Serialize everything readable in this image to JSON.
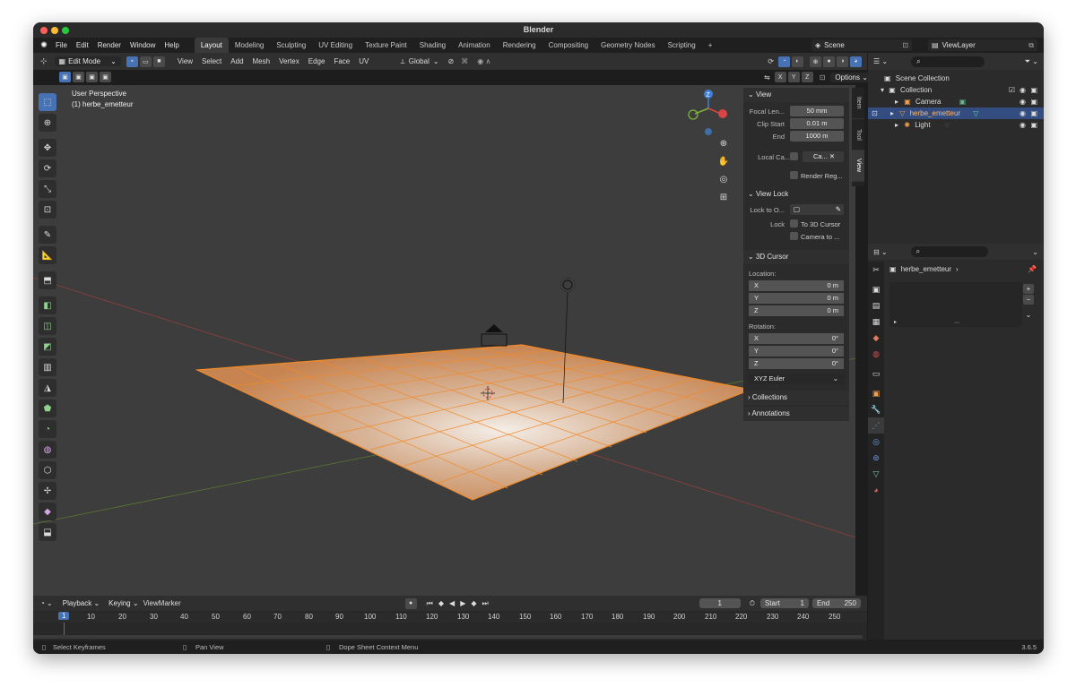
{
  "window": {
    "title": "Blender"
  },
  "menu": [
    "File",
    "Edit",
    "Render",
    "Window",
    "Help"
  ],
  "workspaces": [
    "Layout",
    "Modeling",
    "Sculpting",
    "UV Editing",
    "Texture Paint",
    "Shading",
    "Animation",
    "Rendering",
    "Compositing",
    "Geometry Nodes",
    "Scripting"
  ],
  "workspace_add": "+",
  "scene": {
    "name": "Scene",
    "view_layer": "ViewLayer"
  },
  "viewport_header": {
    "mode": "Edit Mode",
    "menus": [
      "View",
      "Select",
      "Add",
      "Mesh",
      "Vertex",
      "Edge",
      "Face",
      "UV"
    ],
    "orientation": "Global",
    "axis": [
      "X",
      "Y",
      "Z"
    ],
    "options": "Options"
  },
  "viewport": {
    "perspective": "User Perspective",
    "object_label": "(1) herbe_emetteur"
  },
  "side_tabs": [
    "Item",
    "Tool",
    "View"
  ],
  "npanel": {
    "view_title": "View",
    "focal_length": {
      "label": "Focal Len...",
      "value": "50 mm"
    },
    "clip_start": {
      "label": "Clip Start",
      "value": "0.01 m"
    },
    "end": {
      "label": "End",
      "value": "1000 m"
    },
    "local_camera": {
      "label": "Local Ca...",
      "value": "Ca..."
    },
    "render_region": "Render Reg...",
    "view_lock_title": "View Lock",
    "lock_to_object": "Lock to O...",
    "lock": "Lock",
    "to_3d_cursor": "To 3D Cursor",
    "camera_to": "Camera to ...",
    "cursor_title": "3D Cursor",
    "location_label": "Location:",
    "location": [
      {
        "axis": "X",
        "value": "0 m"
      },
      {
        "axis": "Y",
        "value": "0 m"
      },
      {
        "axis": "Z",
        "value": "0 m"
      }
    ],
    "rotation_label": "Rotation:",
    "rotation": [
      {
        "axis": "X",
        "value": "0°"
      },
      {
        "axis": "Y",
        "value": "0°"
      },
      {
        "axis": "Z",
        "value": "0°"
      }
    ],
    "rotation_mode": "XYZ Euler",
    "collections": "Collections",
    "annotations": "Annotations"
  },
  "outliner": {
    "scene_collection": "Scene Collection",
    "collection": "Collection",
    "items": [
      "Camera",
      "herbe_emetteur",
      "Light"
    ]
  },
  "properties": {
    "object_name": "herbe_emetteur"
  },
  "timeline": {
    "menus": [
      "Playback",
      "Keying",
      "View",
      "Marker"
    ],
    "current_frame": "1",
    "start_label": "Start",
    "start": "1",
    "end_label": "End",
    "end": "250",
    "ticks": [
      "1",
      "10",
      "20",
      "30",
      "40",
      "50",
      "60",
      "70",
      "80",
      "90",
      "100",
      "110",
      "120",
      "130",
      "140",
      "150",
      "160",
      "170",
      "180",
      "190",
      "200",
      "210",
      "220",
      "230",
      "240",
      "250"
    ]
  },
  "statusbar": {
    "select": "Select Keyframes",
    "pan": "Pan View",
    "context": "Dope Sheet Context Menu",
    "version": "3.6.5"
  },
  "colors": {
    "accent": "#4772b3",
    "mesh": "#f08a2a"
  }
}
